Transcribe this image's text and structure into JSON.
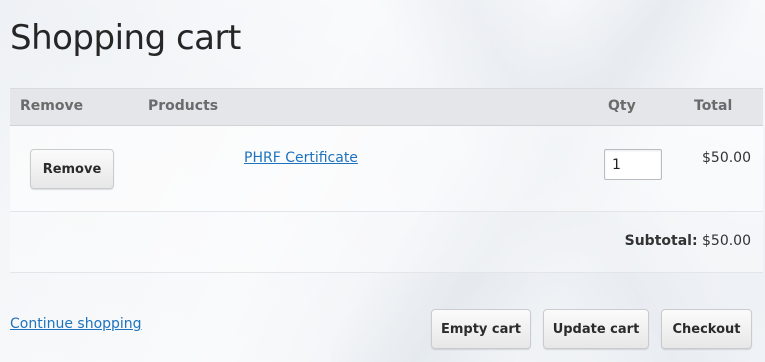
{
  "page": {
    "title": "Shopping cart"
  },
  "cart_table": {
    "columns": [
      "Remove",
      "Products",
      "Qty",
      "Total"
    ],
    "items": [
      {
        "remove_label": "Remove",
        "product": "PHRF Certificate",
        "qty": "1",
        "total": "$50.00"
      }
    ],
    "subtotal_label": "Subtotal:",
    "subtotal_value": "$50.00"
  },
  "actions": {
    "continue_shopping": "Continue shopping",
    "empty_cart": "Empty cart",
    "update_cart": "Update cart",
    "checkout": "Checkout"
  },
  "colors": {
    "link": "#1e73be",
    "header_bg": "#e4e6e9"
  }
}
